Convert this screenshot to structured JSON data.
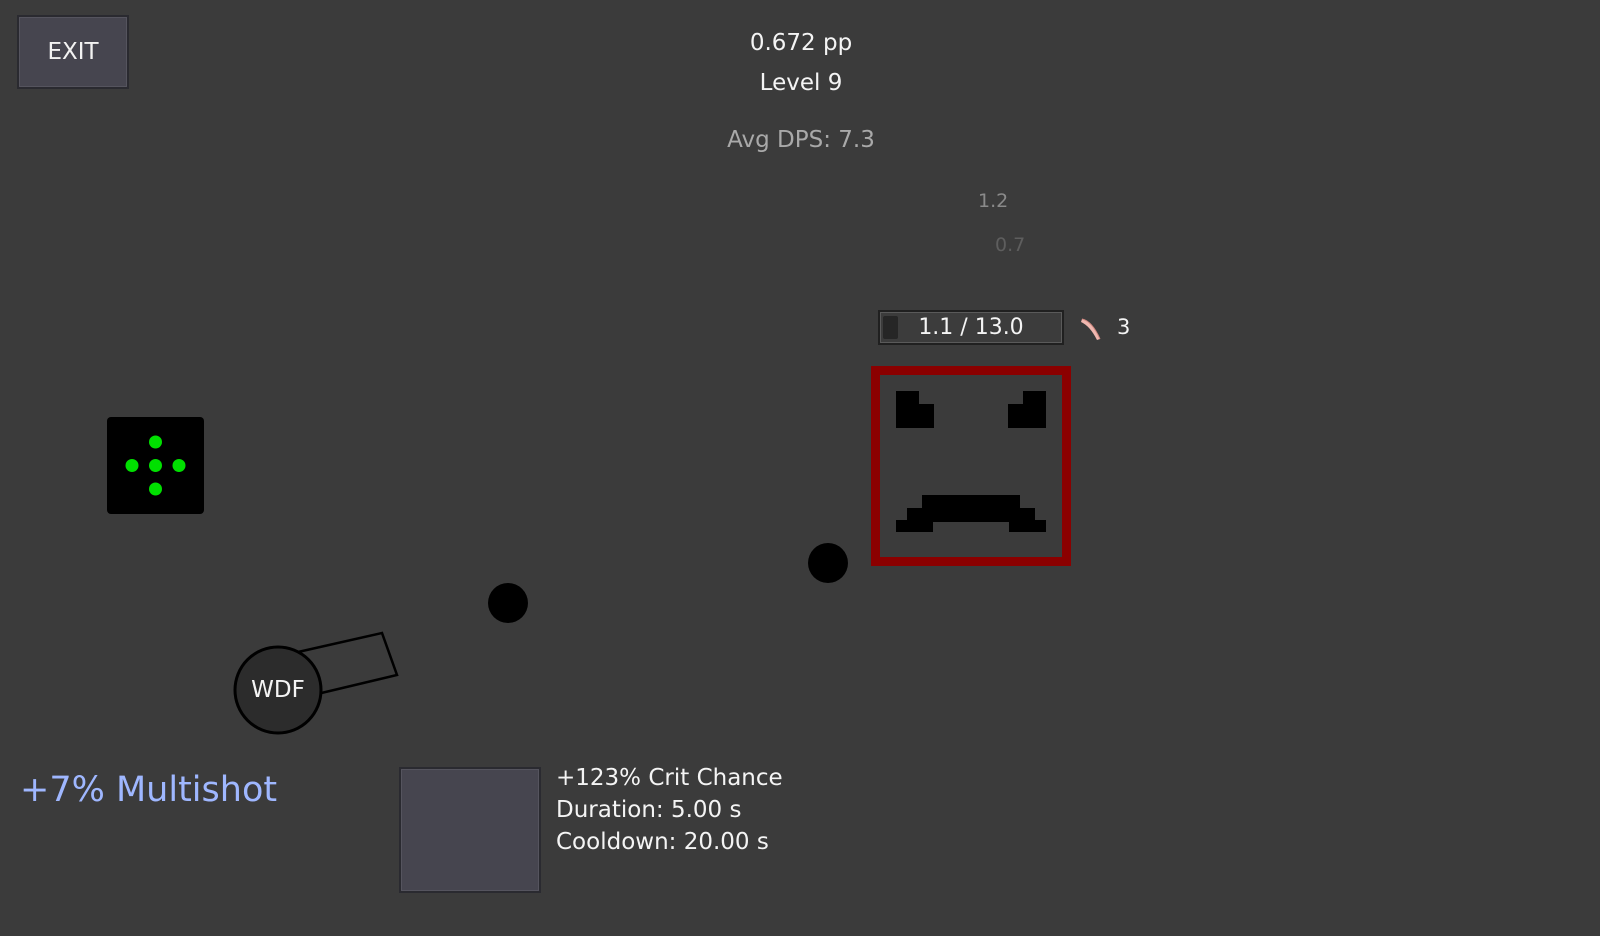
{
  "hud": {
    "exit_label": "EXIT",
    "points": "0.672 pp",
    "level": "Level 9",
    "avg_dps": "Avg DPS: 7.3"
  },
  "damage_numbers": [
    "1.2",
    "0.7"
  ],
  "enemy": {
    "health_text": "1.1 / 13.0",
    "health_fraction": 0.085,
    "armor_count": "3",
    "border_color": "#8b0000"
  },
  "powerup": {
    "dot_color": "#00e000",
    "icon": "multishot-dots-icon"
  },
  "tower": {
    "label": "WDF"
  },
  "buff_text": "+7% Multishot",
  "ability": {
    "title": "+123% Crit Chance",
    "duration": "Duration: 5.00 s",
    "cooldown": "Cooldown: 20.00 s"
  }
}
